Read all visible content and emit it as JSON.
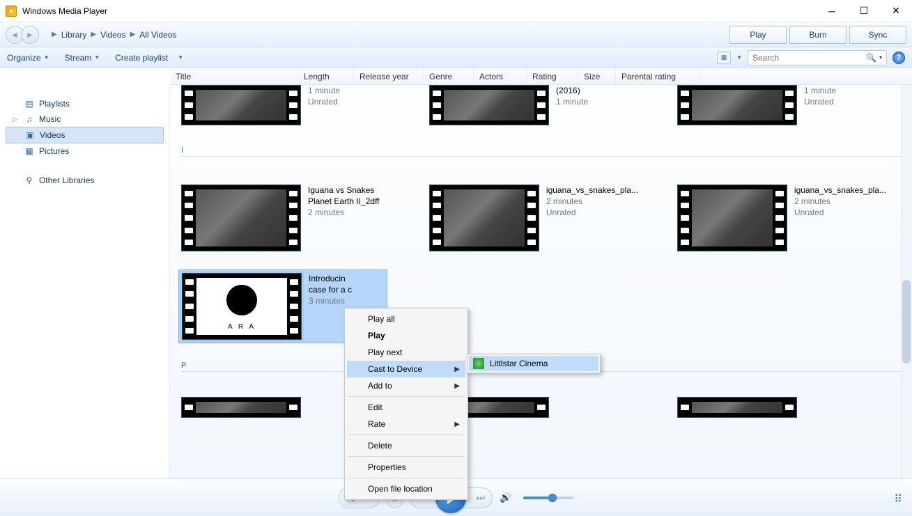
{
  "app": {
    "title": "Windows Media Player"
  },
  "breadcrumb": {
    "a": "Library",
    "b": "Videos",
    "c": "All Videos"
  },
  "tabs": {
    "play": "Play",
    "burn": "Burn",
    "sync": "Sync"
  },
  "toolbar": {
    "organize": "Organize",
    "stream": "Stream",
    "create": "Create playlist"
  },
  "search": {
    "placeholder": "Search"
  },
  "columns": {
    "title": "Title",
    "length": "Length",
    "release": "Release year",
    "genre": "Genre",
    "actors": "Actors",
    "rating": "Rating",
    "size": "Size",
    "parental": "Parental rating"
  },
  "nav": {
    "playlists": "Playlists",
    "music": "Music",
    "videos": "Videos",
    "pictures": "Pictures",
    "other": "Other Libraries"
  },
  "groups": {
    "i": "I",
    "p": "P"
  },
  "row0": {
    "a_len": "1 minute",
    "a_rat": "Unrated",
    "b_year": "(2016)",
    "b_len": "1 minute",
    "c_len": "1 minute",
    "c_rat": "Unrated"
  },
  "row1": {
    "a_t1": "Iguana vs Snakes",
    "a_t2": "Planet Earth II_2dff",
    "a_len": "2 minutes",
    "b_t": "iguana_vs_snakes_pla...",
    "b_len": "2 minutes",
    "b_rat": "Unrated",
    "c_t": "iguana_vs_snakes_pla...",
    "c_len": "2 minutes",
    "c_rat": "Unrated"
  },
  "row2": {
    "a_t1": "Introducin",
    "a_t2": "case for a c",
    "a_len": "3 minutes"
  },
  "ctx": {
    "playall": "Play all",
    "play": "Play",
    "playnext": "Play next",
    "cast": "Cast to Device",
    "addto": "Add to",
    "edit": "Edit",
    "rate": "Rate",
    "delete": "Delete",
    "props": "Properties",
    "open": "Open file location"
  },
  "castsub": {
    "dev": "Littlstar Cinema"
  }
}
